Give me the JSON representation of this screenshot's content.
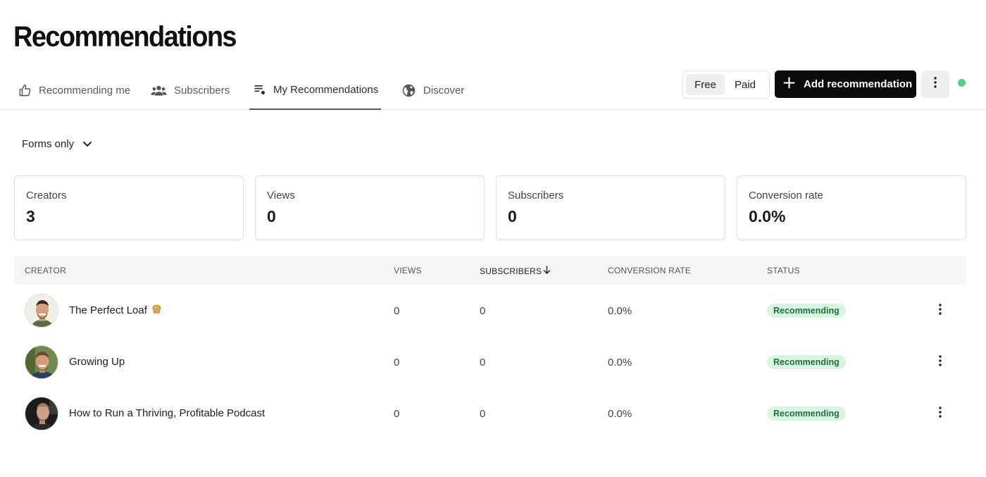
{
  "page": {
    "title": "Recommendations"
  },
  "tabs": [
    {
      "label": "Recommending me",
      "icon": "thumbs-up-icon"
    },
    {
      "label": "Subscribers",
      "icon": "users-icon"
    },
    {
      "label": "My Recommendations",
      "icon": "list-icon",
      "active": true
    },
    {
      "label": "Discover",
      "icon": "globe-icon"
    }
  ],
  "toggle": {
    "free": "Free",
    "paid": "Paid",
    "selected": "Free"
  },
  "actions": {
    "add_label": "Add recommendation"
  },
  "filter": {
    "label": "Forms only"
  },
  "stats": [
    {
      "label": "Creators",
      "value": "3"
    },
    {
      "label": "Views",
      "value": "0"
    },
    {
      "label": "Subscribers",
      "value": "0"
    },
    {
      "label": "Conversion rate",
      "value": "0.0%"
    }
  ],
  "table": {
    "columns": {
      "creator": "CREATOR",
      "views": "VIEWS",
      "subscribers": "SUBSCRIBERS",
      "conversion": "CONVERSION RATE",
      "status": "STATUS"
    },
    "sorted_column": "subscribers",
    "rows": [
      {
        "name": "The Perfect Loaf",
        "emoji_icon": "bread-icon",
        "views": "0",
        "subscribers": "0",
        "conversion": "0.0%",
        "status": "Recommending"
      },
      {
        "name": "Growing Up",
        "views": "0",
        "subscribers": "0",
        "conversion": "0.0%",
        "status": "Recommending"
      },
      {
        "name": "How to Run a Thriving, Profitable Podcast",
        "views": "0",
        "subscribers": "0",
        "conversion": "0.0%",
        "status": "Recommending"
      }
    ]
  },
  "colors": {
    "accent": "#0b0b0b",
    "status_dot": "#4fd38a",
    "badge_bg": "#d8f5e1",
    "badge_text": "#1f6f3a"
  }
}
